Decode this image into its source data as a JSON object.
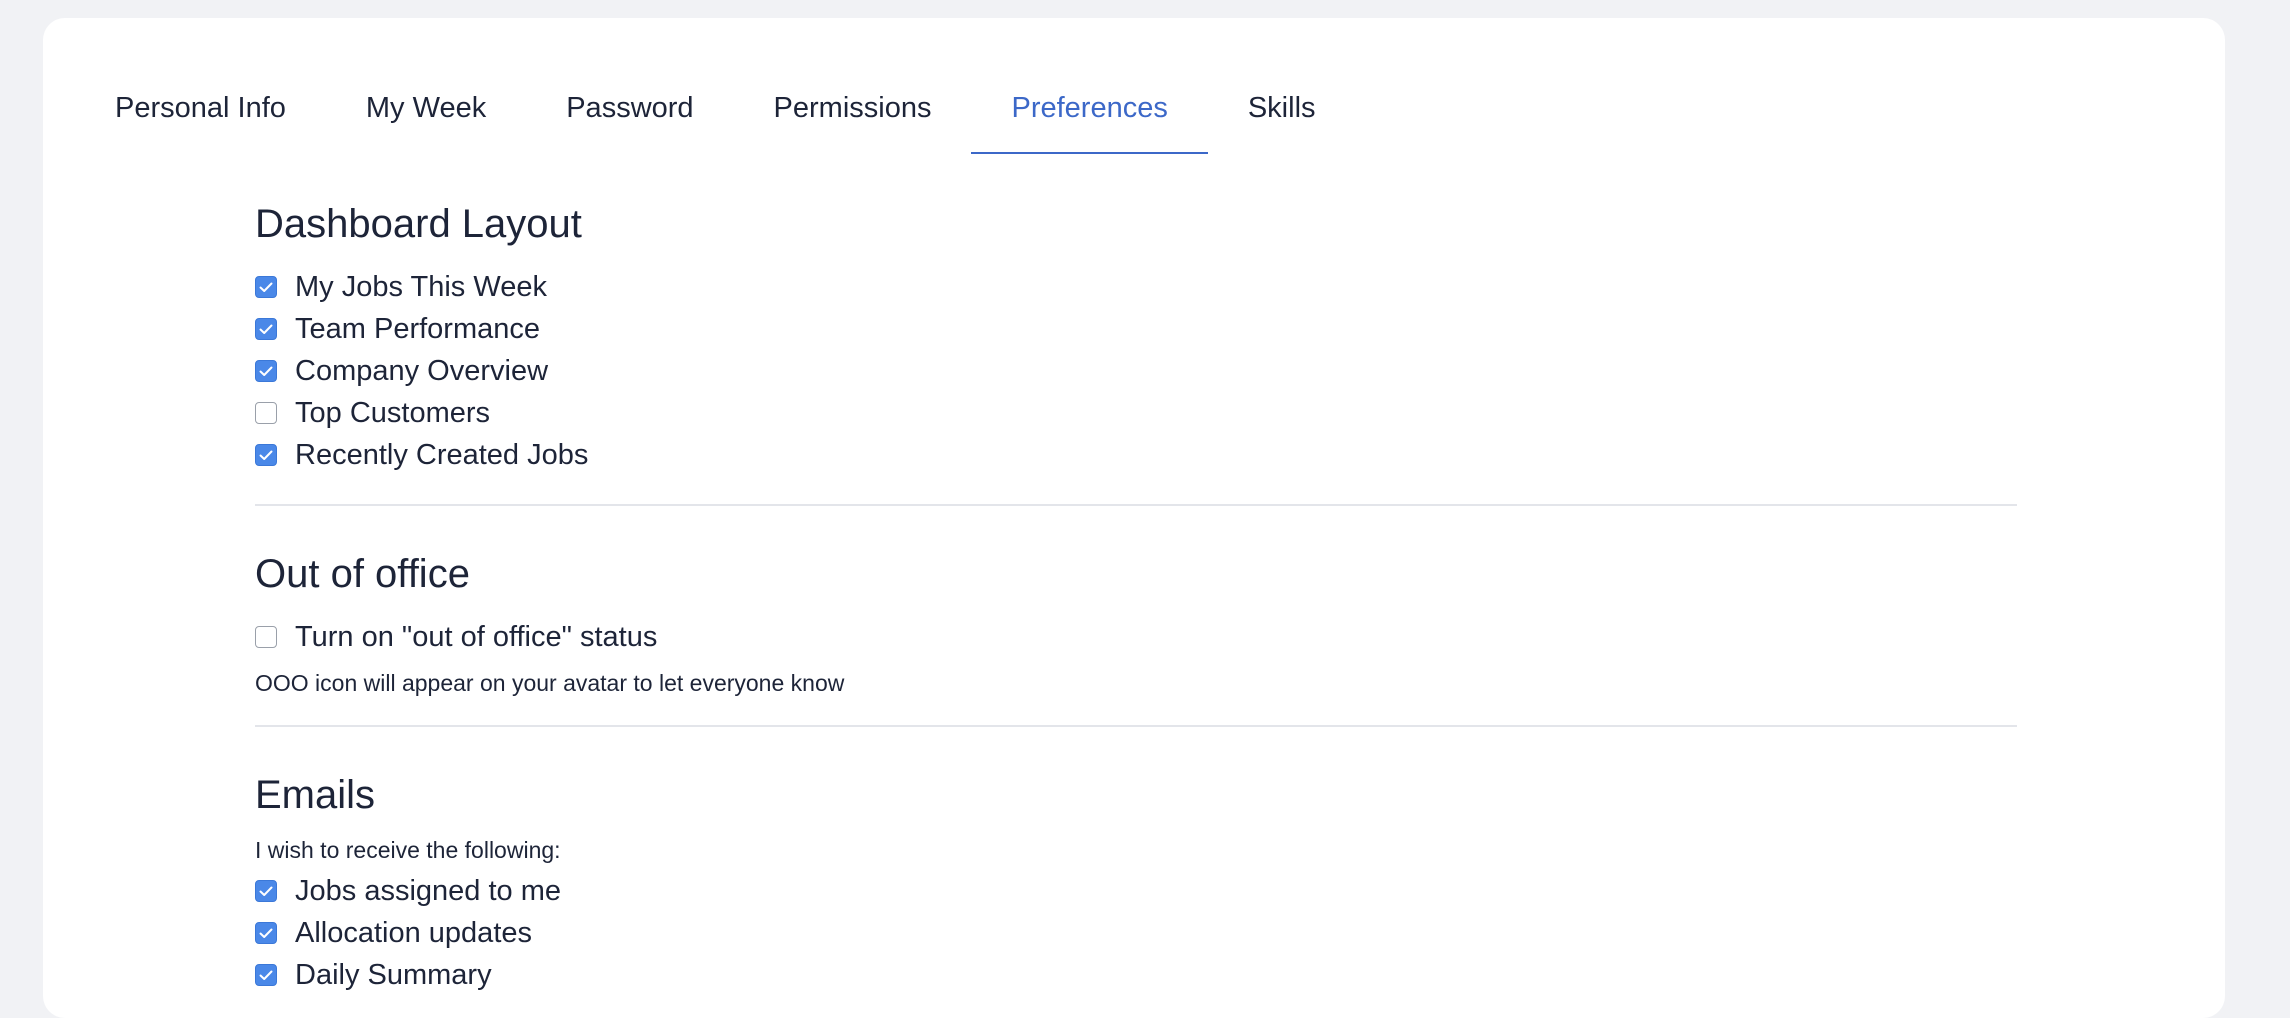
{
  "tabs": [
    {
      "label": "Personal Info",
      "active": false
    },
    {
      "label": "My Week",
      "active": false
    },
    {
      "label": "Password",
      "active": false
    },
    {
      "label": "Permissions",
      "active": false
    },
    {
      "label": "Preferences",
      "active": true
    },
    {
      "label": "Skills",
      "active": false
    }
  ],
  "dashboard": {
    "title": "Dashboard Layout",
    "items": [
      {
        "label": "My Jobs This Week",
        "checked": true
      },
      {
        "label": "Team Performance",
        "checked": true
      },
      {
        "label": "Company Overview",
        "checked": true
      },
      {
        "label": "Top Customers",
        "checked": false
      },
      {
        "label": "Recently Created Jobs",
        "checked": true
      }
    ]
  },
  "out_of_office": {
    "title": "Out of office",
    "toggle": {
      "label": "Turn on \"out of office\" status",
      "checked": false
    },
    "note": "OOO icon will appear on your avatar to let everyone know"
  },
  "emails": {
    "title": "Emails",
    "intro": "I wish to receive the following:",
    "items": [
      {
        "label": "Jobs assigned to me",
        "checked": true
      },
      {
        "label": "Allocation updates",
        "checked": true
      },
      {
        "label": "Daily Summary",
        "checked": true
      }
    ]
  },
  "colors": {
    "accent": "#3c68c8",
    "checkbox": "#4a88e8",
    "background": "#f1f2f5",
    "text": "#1d2438"
  }
}
